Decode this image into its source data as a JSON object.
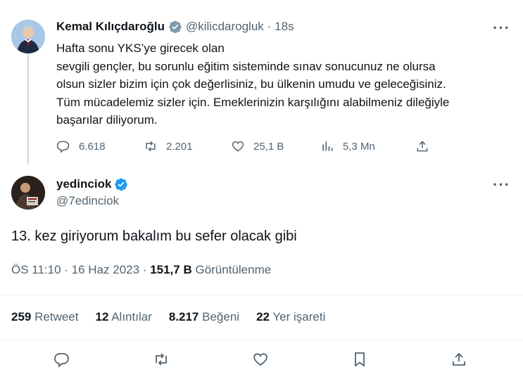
{
  "original_tweet": {
    "author_name": "Kemal Kılıçdaroğlu",
    "handle": "@kilicdarogluk",
    "time": "· 18s",
    "text_lines": [
      "Hafta sonu YKS’ye girecek olan",
      "sevgili gençler, bu sorunlu eğitim sisteminde sınav sonucunuz ne olursa",
      "olsun sizler bizim için çok değerlisiniz, bu ülkenin umudu ve geleceğisiniz.",
      "Tüm mücadelemiz sizler için. Emeklerinizin karşılığını alabilmeniz dileğiyle",
      "başarılar diliyorum."
    ],
    "replies": "6.618",
    "retweets": "2.201",
    "likes": "25,1 B",
    "views": "5,3 Mn",
    "more": "···"
  },
  "reply_tweet": {
    "author_name": "yedinciok",
    "handle": "@7edinciok",
    "more": "···",
    "text": "13. kez giriyorum bakalım bu sefer olacak gibi",
    "timestamp": "ÖS 11:10 · 16 Haz 2023 · ",
    "views_count": "151,7 B",
    "views_label": "Görüntülenme"
  },
  "stats": {
    "retweets_count": "259",
    "retweets_label": "Retweet",
    "quotes_count": "12",
    "quotes_label": "Alıntılar",
    "likes_count": "8.217",
    "likes_label": "Beğeni",
    "bookmarks_count": "22",
    "bookmarks_label": "Yer işareti"
  },
  "colors": {
    "verified_blue": "#1d9bf0",
    "verified_gray": "#829aab",
    "muted": "#536471",
    "divider": "#eff3f4"
  },
  "icons": [
    "reply-icon",
    "retweet-icon",
    "like-icon",
    "views-icon",
    "share-icon",
    "bookmark-icon",
    "verified-badge-icon",
    "more-icon"
  ]
}
